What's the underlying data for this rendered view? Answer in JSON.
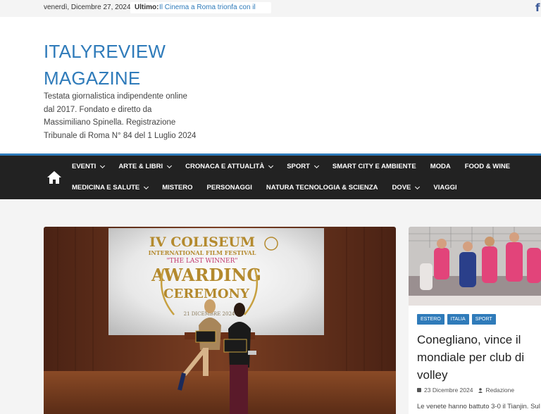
{
  "topbar": {
    "date": "venerdì, Dicembre 27, 2024",
    "ticker_label": "Ultimo:",
    "ticker_text": "Il Cinema a Roma trionfa con il"
  },
  "header": {
    "title": "ITALYREVIEW MAGAZINE",
    "tagline": "Testata giornalistica indipendente online dal 2017. Fondato e diretto da Massimiliano Spinella. Registrazione Tribunale di Roma N° 84 del 1 Luglio 2024"
  },
  "nav": {
    "row1": [
      {
        "label": "EVENTI",
        "dropdown": true
      },
      {
        "label": "ARTE & LIBRI",
        "dropdown": true
      },
      {
        "label": "CRONACA E ATTUALITÀ",
        "dropdown": true
      },
      {
        "label": "SPORT",
        "dropdown": true
      },
      {
        "label": "SMART CITY E AMBIENTE",
        "dropdown": false
      },
      {
        "label": "MODA",
        "dropdown": false
      },
      {
        "label": "FOOD & WINE",
        "dropdown": false
      }
    ],
    "row2": [
      {
        "label": "MEDICINA E SALUTE",
        "dropdown": true
      },
      {
        "label": "MISTERO",
        "dropdown": false
      },
      {
        "label": "PERSONAGGI",
        "dropdown": false
      },
      {
        "label": "NATURA TECNOLOGIA & SCIENZA",
        "dropdown": false
      },
      {
        "label": "DOVE",
        "dropdown": true
      },
      {
        "label": "VIAGGI",
        "dropdown": false
      }
    ]
  },
  "hero": {
    "screen_line1": "IV COLISEUM",
    "screen_line2": "INTERNATIONAL FILM FESTIVAL",
    "screen_line3": "\"THE LAST WINNER\"",
    "screen_line4": "AWARDING",
    "screen_line5": "CEREMONY",
    "screen_line6": "21 DICEMBRE 2024"
  },
  "sidecard": {
    "tags": [
      "ESTERO",
      "ITALIA",
      "SPORT"
    ],
    "title": "Conegliano, vince il mondiale per club di volley",
    "date": "23 Dicembre 2024",
    "author": "Redazione",
    "excerpt": "Le venete hanno battuto 3-0 il Tianjin. Sul"
  },
  "colors": {
    "accent": "#2f7bba",
    "nav_bg": "#222222",
    "facebook": "#3b5998"
  },
  "icons": {
    "facebook": "facebook-icon",
    "home": "home-icon",
    "calendar": "calendar-icon",
    "author": "user-icon"
  }
}
